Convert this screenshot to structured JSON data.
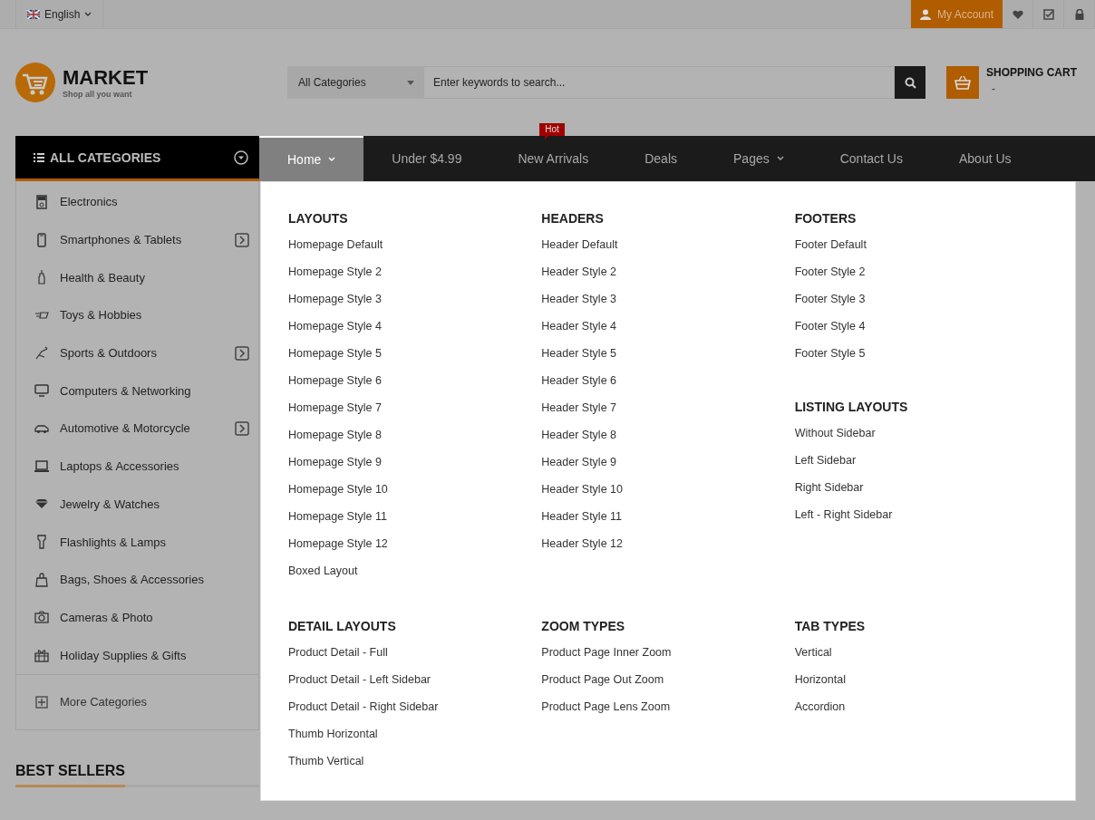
{
  "top_bar": {
    "language": "English",
    "account": "My Account"
  },
  "logo": {
    "name": "MARKET",
    "tagline": "Shop all you want"
  },
  "search": {
    "category": "All Categories",
    "placeholder": "Enter keywords to search..."
  },
  "cart": {
    "title": "SHOPPING CART",
    "value": "-"
  },
  "nav": [
    {
      "label": "Home",
      "selected": true,
      "dropdown": true
    },
    {
      "label": "Under $4.99",
      "selected": false,
      "dropdown": false
    },
    {
      "label": "New Arrivals",
      "selected": false,
      "dropdown": false,
      "badge": "Hot"
    },
    {
      "label": "Deals",
      "selected": false,
      "dropdown": false
    },
    {
      "label": "Pages",
      "selected": false,
      "dropdown": true
    },
    {
      "label": "Contact Us",
      "selected": false,
      "dropdown": false
    },
    {
      "label": "About Us",
      "selected": false,
      "dropdown": false
    }
  ],
  "sidebar": {
    "title": "ALL CATEGORIES",
    "categories": [
      {
        "label": "Electronics",
        "submenu": false
      },
      {
        "label": "Smartphones & Tablets",
        "submenu": true
      },
      {
        "label": "Health & Beauty",
        "submenu": false
      },
      {
        "label": "Toys & Hobbies",
        "submenu": false
      },
      {
        "label": "Sports & Outdoors",
        "submenu": true
      },
      {
        "label": "Computers & Networking",
        "submenu": false
      },
      {
        "label": "Automotive & Motorcycle",
        "submenu": true
      },
      {
        "label": "Laptops & Accessories",
        "submenu": false
      },
      {
        "label": "Jewelry & Watches",
        "submenu": false
      },
      {
        "label": "Flashlights & Lamps",
        "submenu": false
      },
      {
        "label": "Bags, Shoes & Accessories",
        "submenu": false
      },
      {
        "label": "Cameras & Photo",
        "submenu": false
      },
      {
        "label": "Holiday Supplies & Gifts",
        "submenu": false
      }
    ],
    "more": "More Categories"
  },
  "mega_menu": {
    "rows": [
      [
        [
          {
            "title": "LAYOUTS",
            "links": [
              "Homepage Default",
              "Homepage Style 2",
              "Homepage Style 3",
              "Homepage Style 4",
              "Homepage Style 5",
              "Homepage Style 6",
              "Homepage Style 7",
              "Homepage Style 8",
              "Homepage Style 9",
              "Homepage Style 10",
              "Homepage Style 11",
              "Homepage Style 12",
              "Boxed Layout"
            ]
          }
        ],
        [
          {
            "title": "HEADERS",
            "links": [
              "Header Default",
              "Header Style 2",
              "Header Style 3",
              "Header Style 4",
              "Header Style 5",
              "Header Style 6",
              "Header Style 7",
              "Header Style 8",
              "Header Style 9",
              "Header Style 10",
              "Header Style 11",
              "Header Style 12"
            ]
          }
        ],
        [
          {
            "title": "FOOTERS",
            "links": [
              "Footer Default",
              "Footer Style 2",
              "Footer Style 3",
              "Footer Style 4",
              "Footer Style 5"
            ]
          },
          {
            "title": "LISTING LAYOUTS",
            "links": [
              "Without Sidebar",
              "Left Sidebar",
              "Right Sidebar",
              "Left - Right Sidebar"
            ]
          }
        ]
      ],
      [
        [
          {
            "title": "DETAIL LAYOUTS",
            "links": [
              "Product Detail - Full",
              "Product Detail - Left Sidebar",
              "Product Detail - Right Sidebar",
              "Thumb Horizontal",
              "Thumb Vertical"
            ]
          }
        ],
        [
          {
            "title": "ZOOM TYPES",
            "links": [
              "Product Page Inner Zoom",
              "Product Page Out Zoom",
              "Product Page Lens Zoom"
            ]
          }
        ],
        [
          {
            "title": "TAB TYPES",
            "links": [
              "Vertical",
              "Horizontal",
              "Accordion"
            ]
          }
        ]
      ]
    ]
  },
  "section_title": "BEST SELLERS"
}
